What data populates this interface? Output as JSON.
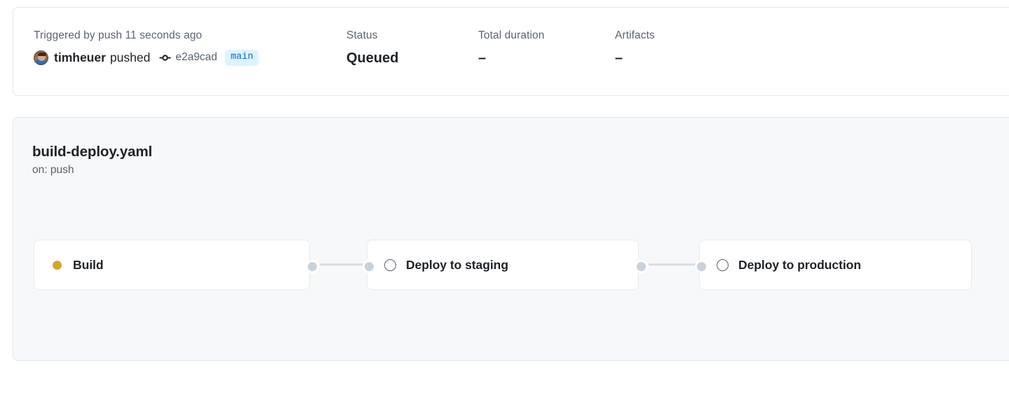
{
  "summary": {
    "trigger": {
      "label": "Triggered by push 11 seconds ago",
      "actor": "timheuer",
      "action": "pushed",
      "commit_icon": "git-commit-icon",
      "commit_sha": "e2a9cad",
      "branch": "main"
    },
    "status": {
      "label": "Status",
      "value": "Queued"
    },
    "duration": {
      "label": "Total duration",
      "value": "–"
    },
    "artifacts": {
      "label": "Artifacts",
      "value": "–"
    }
  },
  "workflow": {
    "title": "build-deploy.yaml",
    "subtitle": "on: push",
    "jobs": [
      {
        "name": "Build",
        "status_icon": "pending-dot-icon",
        "status": "pending"
      },
      {
        "name": "Deploy to staging",
        "status_icon": "neutral-circle-icon",
        "status": "waiting"
      },
      {
        "name": "Deploy to production",
        "status_icon": "neutral-circle-icon",
        "status": "waiting"
      }
    ]
  },
  "colors": {
    "pending": "#d4a72c",
    "neutral": "#57606a",
    "branch_badge_bg": "#ddf4ff",
    "branch_badge_fg": "#0969da",
    "connector": "#d8dee4",
    "card_bg": "#f6f8fa"
  }
}
